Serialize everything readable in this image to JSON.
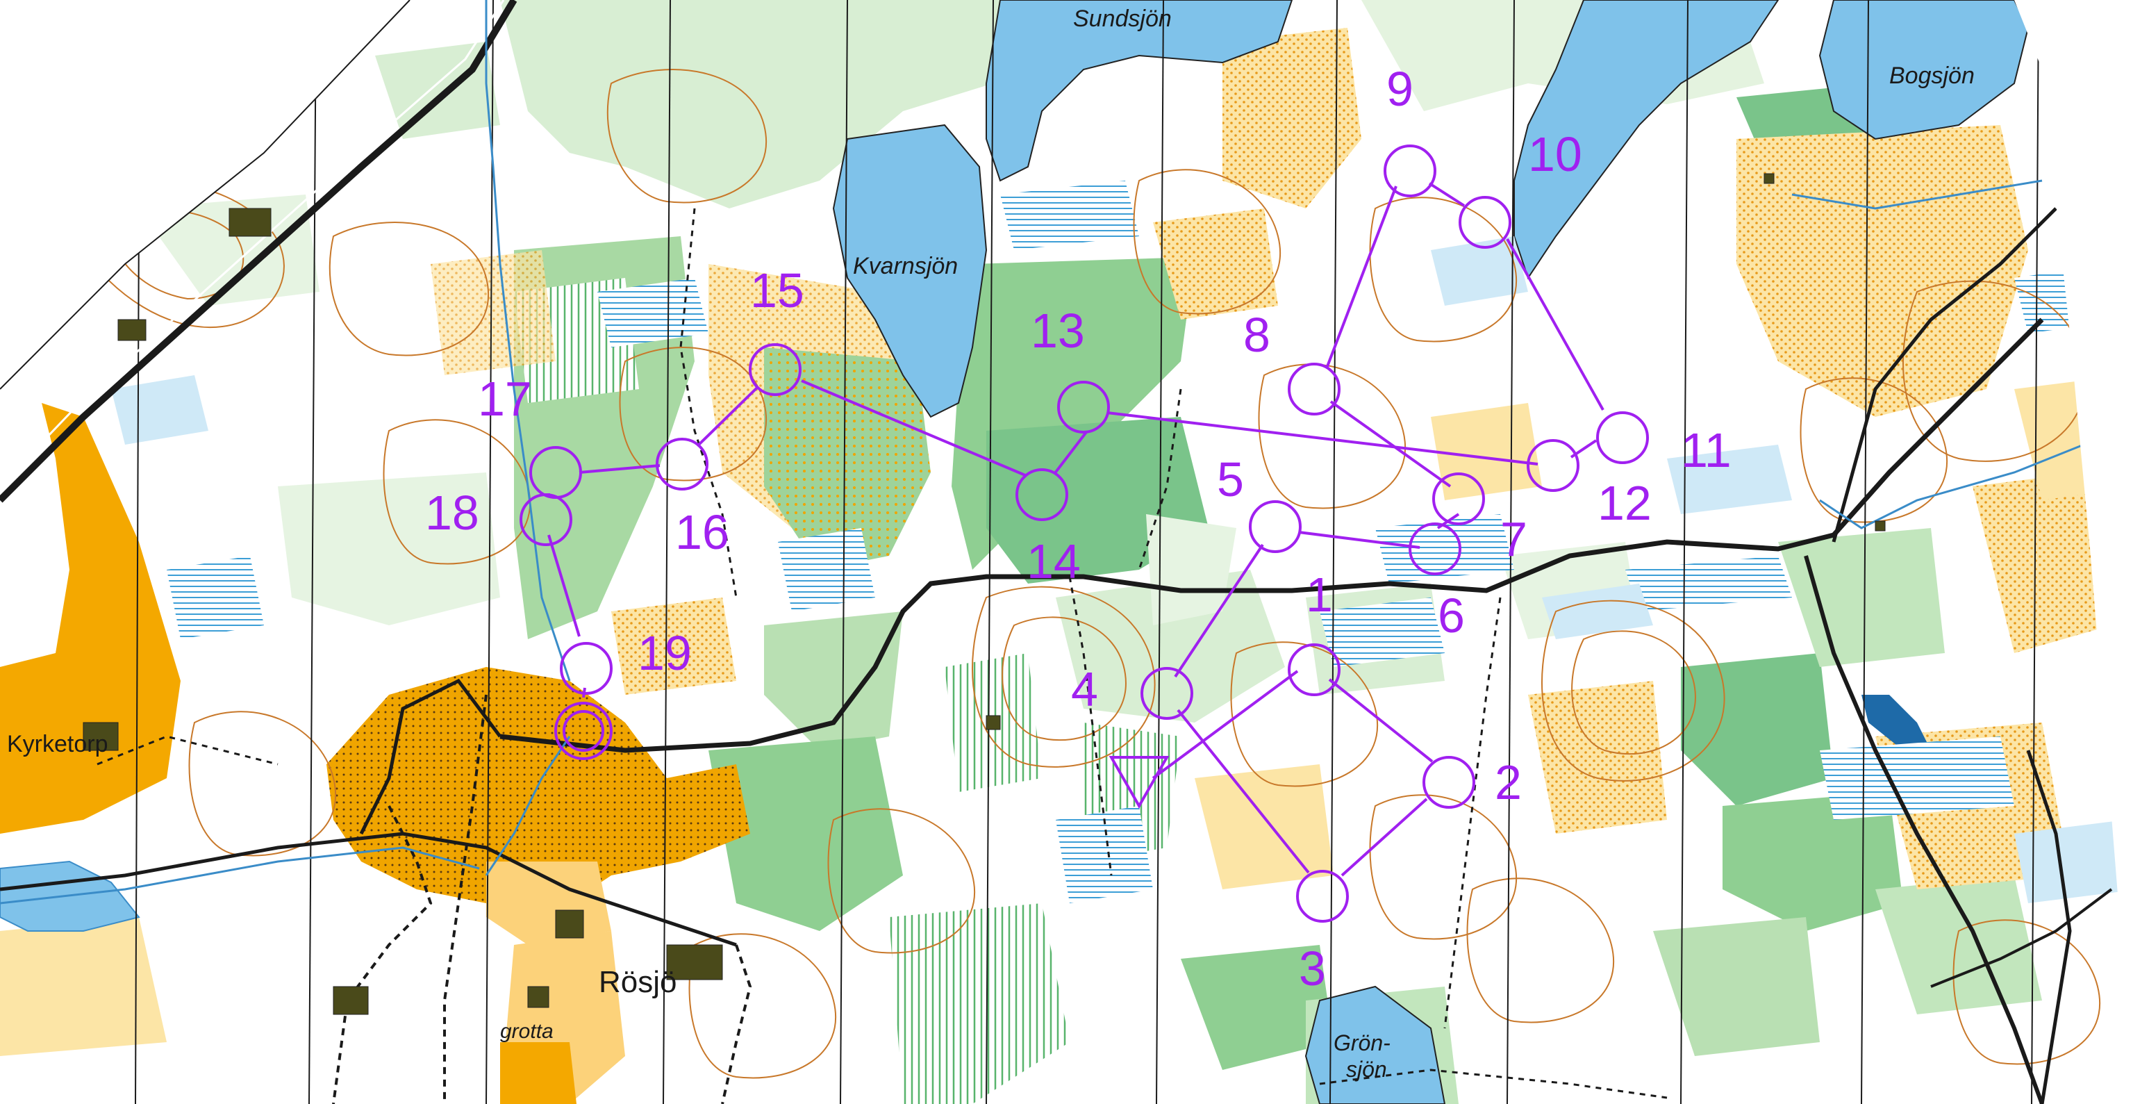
{
  "map": {
    "place_names": [
      {
        "id": "sundsjon",
        "text": "Sundsjön"
      },
      {
        "id": "bogsjon",
        "text": "Bogsjön"
      },
      {
        "id": "kvarnsjon",
        "text": "Kvarnsjön"
      },
      {
        "id": "kyrketorp",
        "text": "Kyrketorp"
      },
      {
        "id": "rosjo",
        "text": "Rösjö"
      },
      {
        "id": "grotta",
        "text": "grotta"
      },
      {
        "id": "gronsjon-1",
        "text": "Grön-"
      },
      {
        "id": "gronsjon-2",
        "text": "sjön"
      }
    ],
    "course": {
      "color": "#a020f0",
      "start_symbol": "start-triangle",
      "finish_symbol": "finish-double-circle",
      "controls": [
        "1",
        "2",
        "3",
        "4",
        "5",
        "6",
        "7",
        "8",
        "9",
        "10",
        "11",
        "12",
        "13",
        "14",
        "15",
        "16",
        "17",
        "18",
        "19"
      ]
    },
    "colors": {
      "forest": "#ffffff",
      "open_land": "#f7b500",
      "rough_open": "#fce5a6",
      "green": "#7ac48a",
      "light_green": "#c2e6bd",
      "water": "#7fc2ea",
      "marsh": "#5ab0e0",
      "contour": "#c8782a",
      "road": "#1a1a1a",
      "course": "#a020f0"
    }
  }
}
